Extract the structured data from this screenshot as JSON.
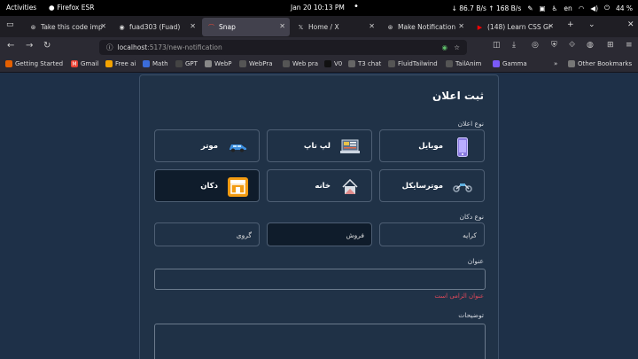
{
  "system_bar": {
    "activities": "Activities",
    "app_name": "Firefox ESR",
    "clock": "Jan 20  10:13 PM",
    "net": "↓ 86.7 B/s ↑ 168 B/s",
    "lang": "en",
    "battery": "44 %"
  },
  "tabs": [
    {
      "label": "Take this code imp",
      "icon": "chatgpt-icon"
    },
    {
      "label": "fuad303 (Fuad)",
      "icon": "github-icon"
    },
    {
      "label": "Snap",
      "icon": "snap-icon",
      "active": true
    },
    {
      "label": "Home / X",
      "icon": "x-icon"
    },
    {
      "label": "Make Notification",
      "icon": "chatgpt-icon"
    },
    {
      "label": "(148) Learn CSS Gr",
      "icon": "youtube-icon"
    }
  ],
  "url": {
    "host": "localhost",
    "path": ":5173/new-notification"
  },
  "bookmarks": [
    {
      "label": "Getting Started",
      "color": "#e66000"
    },
    {
      "label": "Gmail",
      "color": "#ea4335"
    },
    {
      "label": "Free ai",
      "color": "#f4a300"
    },
    {
      "label": "Math",
      "color": "#3b6cd9"
    },
    {
      "label": "GPT",
      "color": "#444"
    },
    {
      "label": "WebP",
      "color": "#888"
    },
    {
      "label": "WebPra",
      "color": "#555"
    },
    {
      "label": "Web pra",
      "color": "#555"
    },
    {
      "label": "V0",
      "color": "#111"
    },
    {
      "label": "T3 chat",
      "color": "#666"
    },
    {
      "label": "FluidTailwind",
      "color": "#555"
    },
    {
      "label": "TailAnim",
      "color": "#555"
    },
    {
      "label": "Gamma",
      "color": "#7a5af8"
    },
    {
      "label": "Other Bookmarks",
      "color": "#777"
    }
  ],
  "form": {
    "title": "ثبت اعلان",
    "ad_type_label": "نوع اعلان",
    "ad_types": [
      {
        "label": "موبایل",
        "icon": "mobile-icon"
      },
      {
        "label": "لپ تاپ",
        "icon": "laptop-icon"
      },
      {
        "label": "موتر",
        "icon": "car-icon"
      },
      {
        "label": "موترسایکل",
        "icon": "motorcycle-icon"
      },
      {
        "label": "خانه",
        "icon": "house-icon"
      },
      {
        "label": "دکان",
        "icon": "shop-icon",
        "selected": true
      }
    ],
    "shop_type_label": "نوع دکان",
    "shop_types": [
      {
        "label": "کرایه"
      },
      {
        "label": "فروش",
        "selected": true
      },
      {
        "label": "گروی"
      }
    ],
    "title_label": "عنوان",
    "title_value": "",
    "title_error": "عنوان الزامی است",
    "desc_label": "توضیحات",
    "desc_value": ""
  }
}
